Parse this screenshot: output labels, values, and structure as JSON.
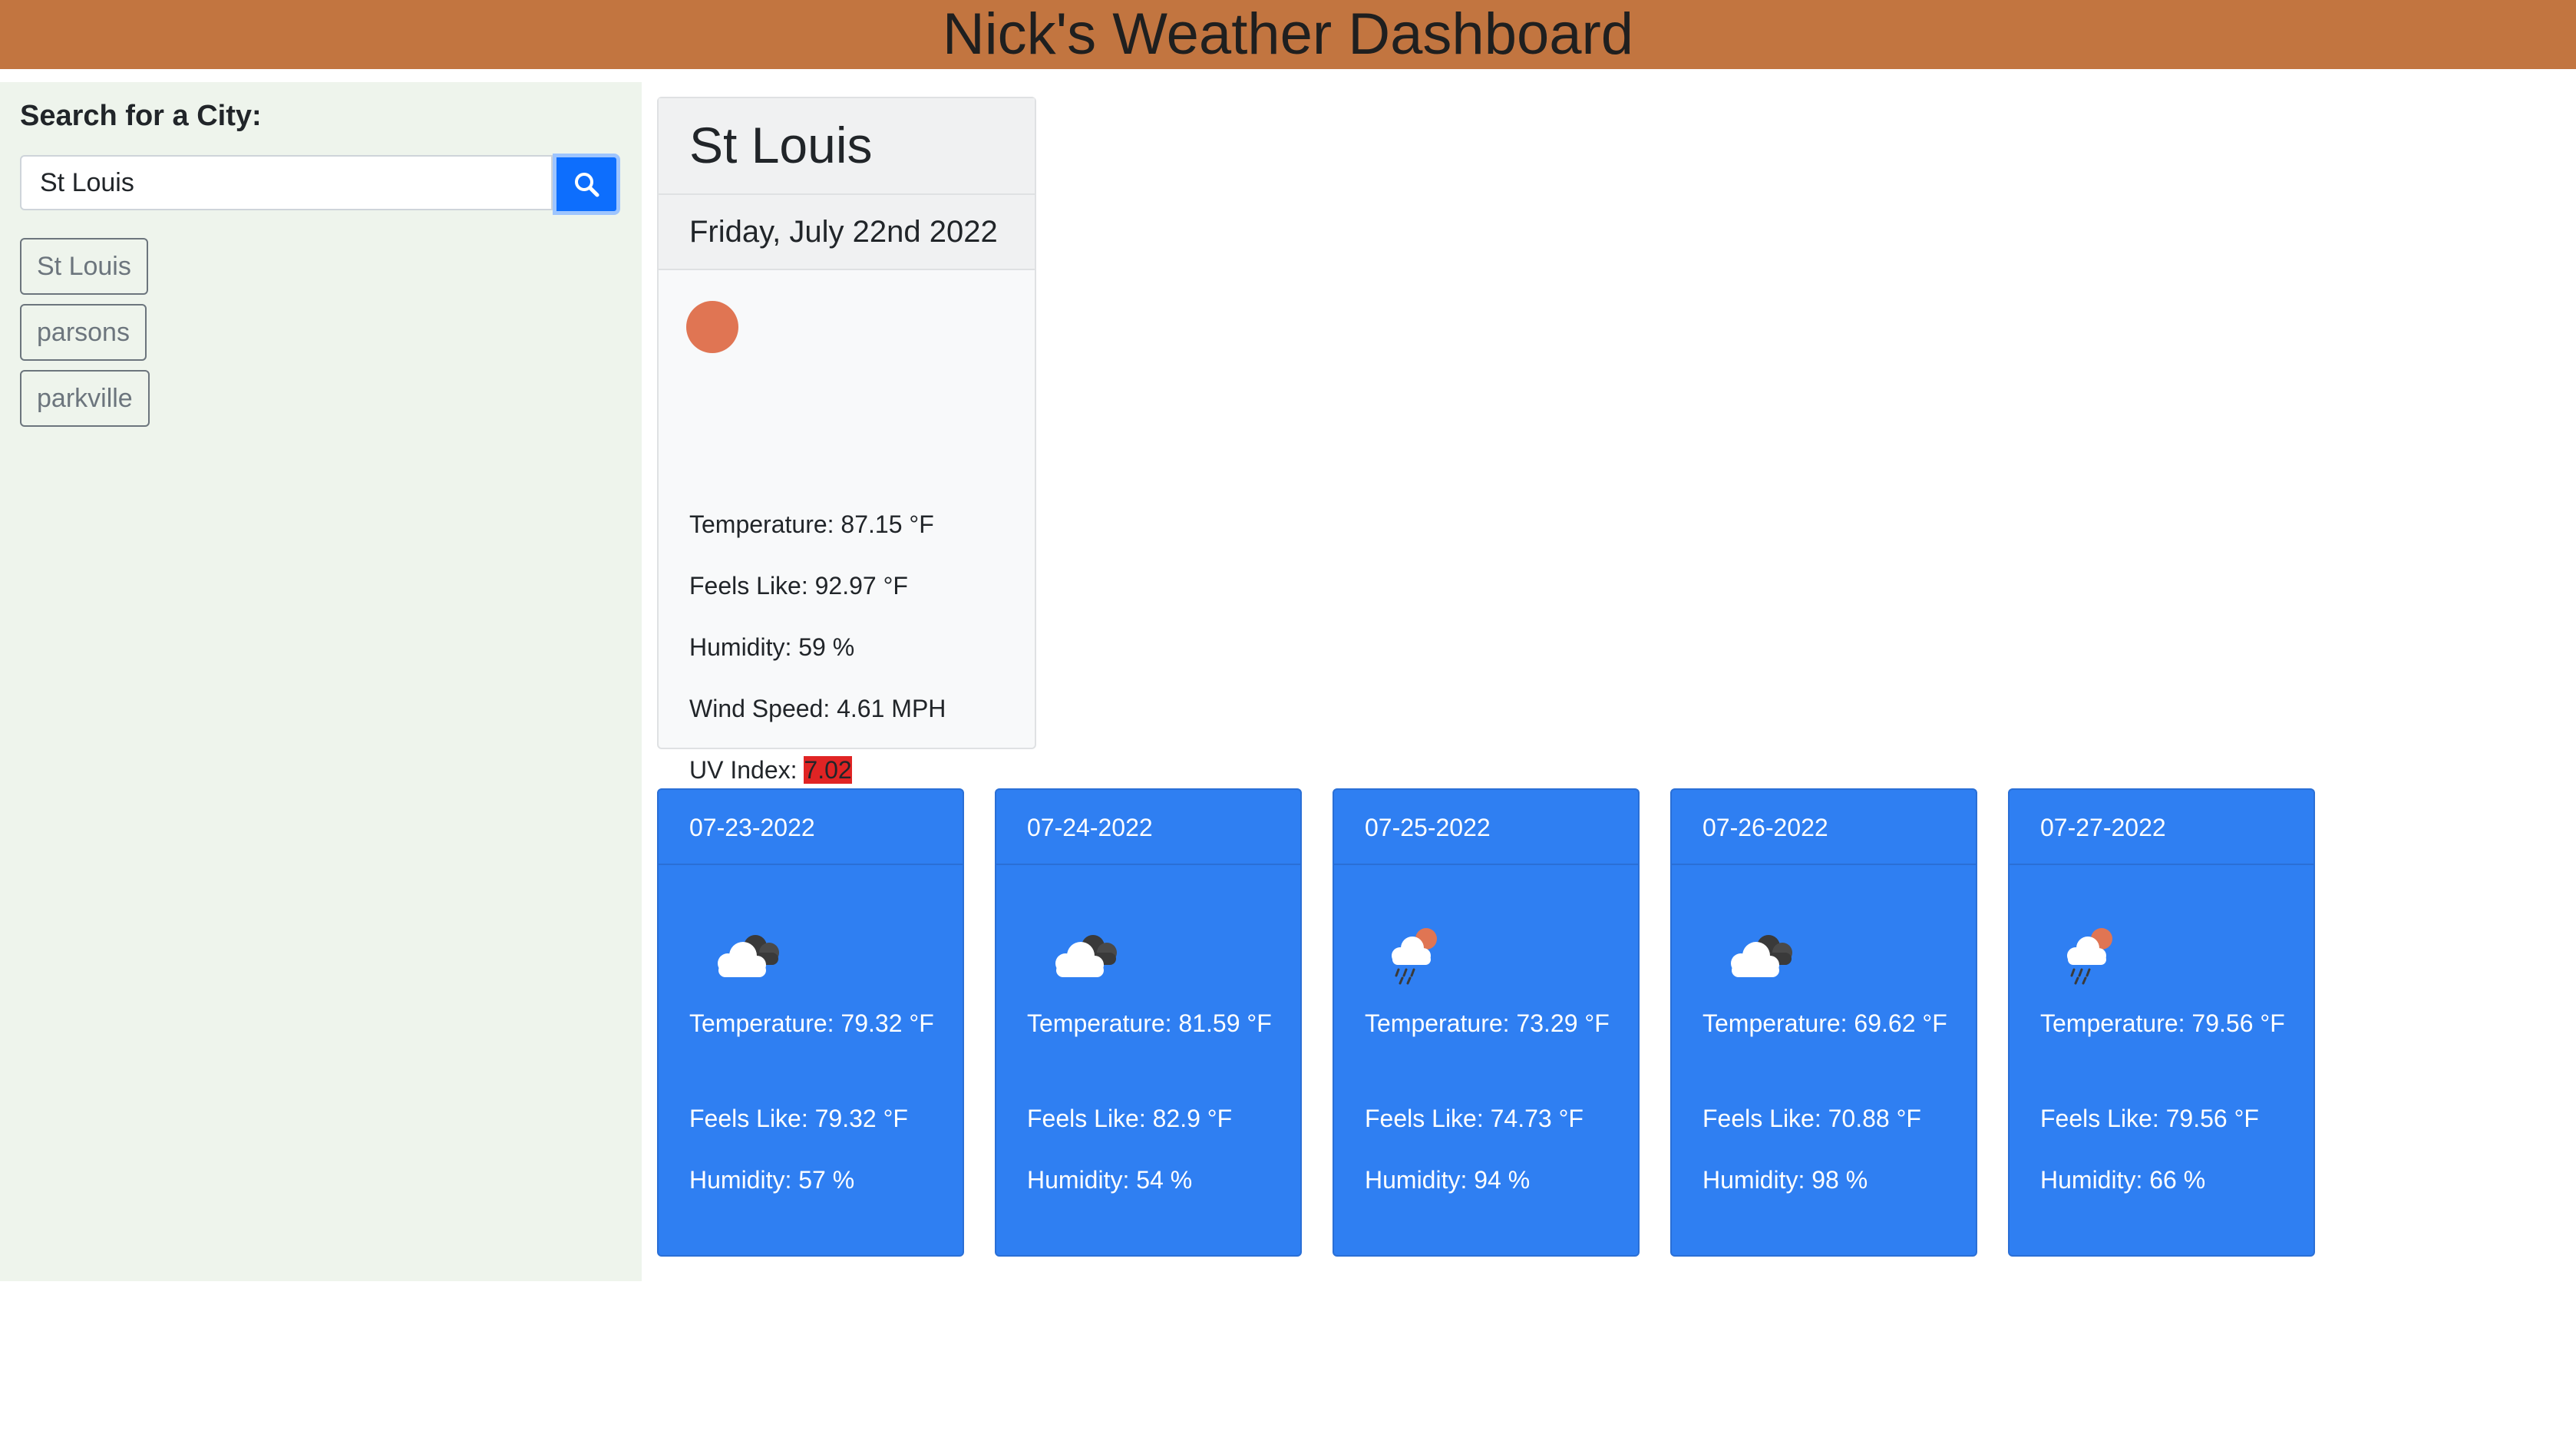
{
  "header": {
    "title": "Nick's Weather Dashboard"
  },
  "sidebar": {
    "search_label": "Search for a City:",
    "search_value": "St Louis",
    "history": [
      "St Louis",
      "parsons",
      "parkville"
    ]
  },
  "current": {
    "city": "St Louis",
    "date": "Friday, July 22nd 2022",
    "temperature": "Temperature: 87.15 °F",
    "feels_like": "Feels Like: 92.97 °F",
    "humidity": "Humidity: 59 %",
    "wind": "Wind Speed: 4.61 MPH",
    "uv_label": "UV Index: ",
    "uv_value": "7.02",
    "uv_color": "#e02424",
    "icon": "sun-icon"
  },
  "forecast": [
    {
      "date": "07-23-2022",
      "icon": "broken-clouds-icon",
      "temperature": "Temperature: 79.32 °F",
      "feels_like": "Feels Like: 79.32 °F",
      "humidity": "Humidity: 57 %"
    },
    {
      "date": "07-24-2022",
      "icon": "broken-clouds-icon",
      "temperature": "Temperature: 81.59 °F",
      "feels_like": "Feels Like: 82.9 °F",
      "humidity": "Humidity: 54 %"
    },
    {
      "date": "07-25-2022",
      "icon": "rain-sun-icon",
      "temperature": "Temperature: 73.29 °F",
      "feels_like": "Feels Like: 74.73 °F",
      "humidity": "Humidity: 94 %"
    },
    {
      "date": "07-26-2022",
      "icon": "broken-clouds-icon",
      "temperature": "Temperature: 69.62 °F",
      "feels_like": "Feels Like: 70.88 °F",
      "humidity": "Humidity: 98 %"
    },
    {
      "date": "07-27-2022",
      "icon": "rain-sun-icon",
      "temperature": "Temperature: 79.56 °F",
      "feels_like": "Feels Like: 79.56 °F",
      "humidity": "Humidity: 66 %"
    }
  ],
  "colors": {
    "header_bg": "#c27540",
    "sidebar_bg": "#eef4ec",
    "forecast_bg": "#2f7ff2",
    "search_button": "#0d6efd"
  }
}
